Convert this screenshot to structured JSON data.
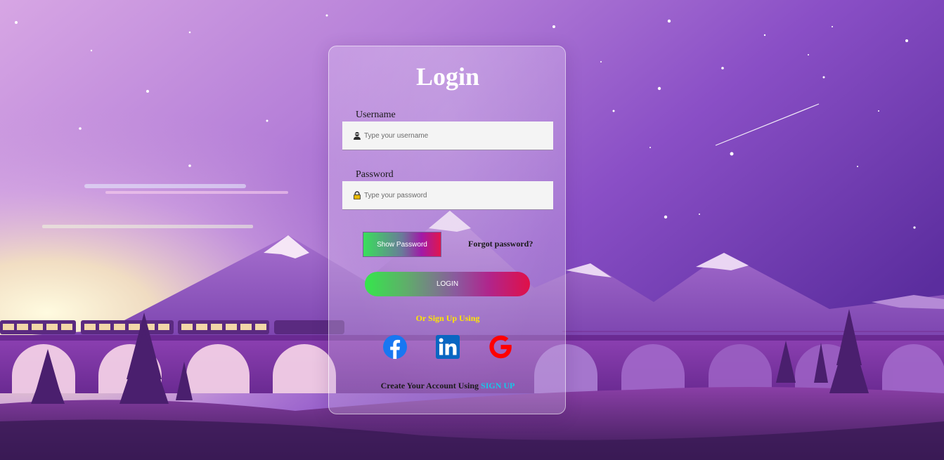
{
  "login": {
    "title": "Login",
    "username": {
      "label": "Username",
      "placeholder": "Type your username",
      "icon": "user-icon"
    },
    "password": {
      "label": "Password",
      "placeholder": "Type your password",
      "icon": "lock-icon"
    },
    "show_password_label": "Show Password",
    "forgot_label": "Forgot password?",
    "login_label": "LOGIN",
    "or_text": "Or Sign Up Using",
    "social": [
      {
        "name": "facebook-icon",
        "color": "#1877f2"
      },
      {
        "name": "linkedin-icon",
        "color": "#0a66c2"
      },
      {
        "name": "google-icon",
        "color": "#ff0000"
      }
    ],
    "create_text": "Create Your Account Using",
    "signup_label": "SIGN UP"
  },
  "colors": {
    "sky_top": "#8a4fc6",
    "accent_signup": "#19c6e6",
    "accent_or": "#ffe600"
  }
}
